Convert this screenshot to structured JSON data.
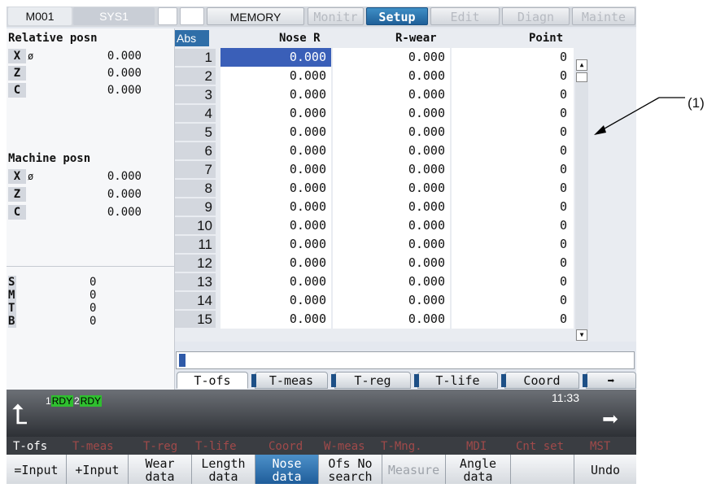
{
  "topbar": {
    "system": "M001",
    "sys": "SYS1",
    "blank1": "",
    "mode": "MEMORY",
    "tabs": [
      "Monitr",
      "Setup",
      "Edit",
      "Diagn",
      "Mainte"
    ],
    "active_tab": "Setup"
  },
  "left": {
    "relative_title": "Relative posn",
    "relative": [
      {
        "axis": "X",
        "dia": "ø",
        "value": "0.000"
      },
      {
        "axis": "Z",
        "dia": "",
        "value": "0.000"
      },
      {
        "axis": "C",
        "dia": "",
        "value": "0.000"
      }
    ],
    "machine_title": "Machine posn",
    "machine": [
      {
        "axis": "X",
        "dia": "ø",
        "value": "0.000"
      },
      {
        "axis": "Z",
        "dia": "",
        "value": "0.000"
      },
      {
        "axis": "C",
        "dia": "",
        "value": "0.000"
      }
    ],
    "smtb": [
      {
        "label": "S",
        "value": "0"
      },
      {
        "label": "M",
        "value": "0"
      },
      {
        "label": "T",
        "value": "0"
      },
      {
        "label": "B",
        "value": "0"
      }
    ]
  },
  "table": {
    "abs_label": "Abs",
    "headers": [
      "Nose R",
      "R-wear",
      "Point"
    ],
    "rows": [
      {
        "no": "1",
        "nose_r": "0.000",
        "r_wear": "0.000",
        "point": "0"
      },
      {
        "no": "2",
        "nose_r": "0.000",
        "r_wear": "0.000",
        "point": "0"
      },
      {
        "no": "3",
        "nose_r": "0.000",
        "r_wear": "0.000",
        "point": "0"
      },
      {
        "no": "4",
        "nose_r": "0.000",
        "r_wear": "0.000",
        "point": "0"
      },
      {
        "no": "5",
        "nose_r": "0.000",
        "r_wear": "0.000",
        "point": "0"
      },
      {
        "no": "6",
        "nose_r": "0.000",
        "r_wear": "0.000",
        "point": "0"
      },
      {
        "no": "7",
        "nose_r": "0.000",
        "r_wear": "0.000",
        "point": "0"
      },
      {
        "no": "8",
        "nose_r": "0.000",
        "r_wear": "0.000",
        "point": "0"
      },
      {
        "no": "9",
        "nose_r": "0.000",
        "r_wear": "0.000",
        "point": "0"
      },
      {
        "no": "10",
        "nose_r": "0.000",
        "r_wear": "0.000",
        "point": "0"
      },
      {
        "no": "11",
        "nose_r": "0.000",
        "r_wear": "0.000",
        "point": "0"
      },
      {
        "no": "12",
        "nose_r": "0.000",
        "r_wear": "0.000",
        "point": "0"
      },
      {
        "no": "13",
        "nose_r": "0.000",
        "r_wear": "0.000",
        "point": "0"
      },
      {
        "no": "14",
        "nose_r": "0.000",
        "r_wear": "0.000",
        "point": "0"
      },
      {
        "no": "15",
        "nose_r": "0.000",
        "r_wear": "0.000",
        "point": "0"
      }
    ],
    "selected_row": 0
  },
  "input_line": "",
  "subtabs": [
    "T-ofs",
    "T-meas",
    "T-reg",
    "T-life",
    "Coord"
  ],
  "subtab_active": "T-ofs",
  "status": {
    "rdy1_num": "1",
    "rdy1": "RDY",
    "rdy2_num": "2",
    "rdy2": "RDY",
    "clock": "11:33"
  },
  "menu": [
    "T-ofs",
    "T-meas",
    "T-reg",
    "T-life",
    "Coord",
    "W-meas",
    "T-Mng.",
    "MDI",
    "Cnt set",
    "MST"
  ],
  "menu_active": "T-ofs",
  "fkeys": [
    {
      "line1": "=Input",
      "line2": ""
    },
    {
      "line1": "+Input",
      "line2": ""
    },
    {
      "line1": "Wear",
      "line2": "data"
    },
    {
      "line1": "Length",
      "line2": "data"
    },
    {
      "line1": "Nose",
      "line2": "data"
    },
    {
      "line1": "Ofs No",
      "line2": "search"
    },
    {
      "line1": "Measure",
      "line2": ""
    },
    {
      "line1": "Angle",
      "line2": "data"
    },
    {
      "line1": "",
      "line2": ""
    },
    {
      "line1": "Undo",
      "line2": ""
    }
  ],
  "annotation": "(1)",
  "colors": {
    "active_tab": "#2a6fa8",
    "selection": "#3a5fb8",
    "rdy": "#2fbf2f",
    "footer_dark": "#3a3d42"
  },
  "icons": [
    "menu-return-icon",
    "menu-next-icon",
    "tab-next-icon",
    "scroll-up-icon",
    "scroll-down-icon"
  ]
}
